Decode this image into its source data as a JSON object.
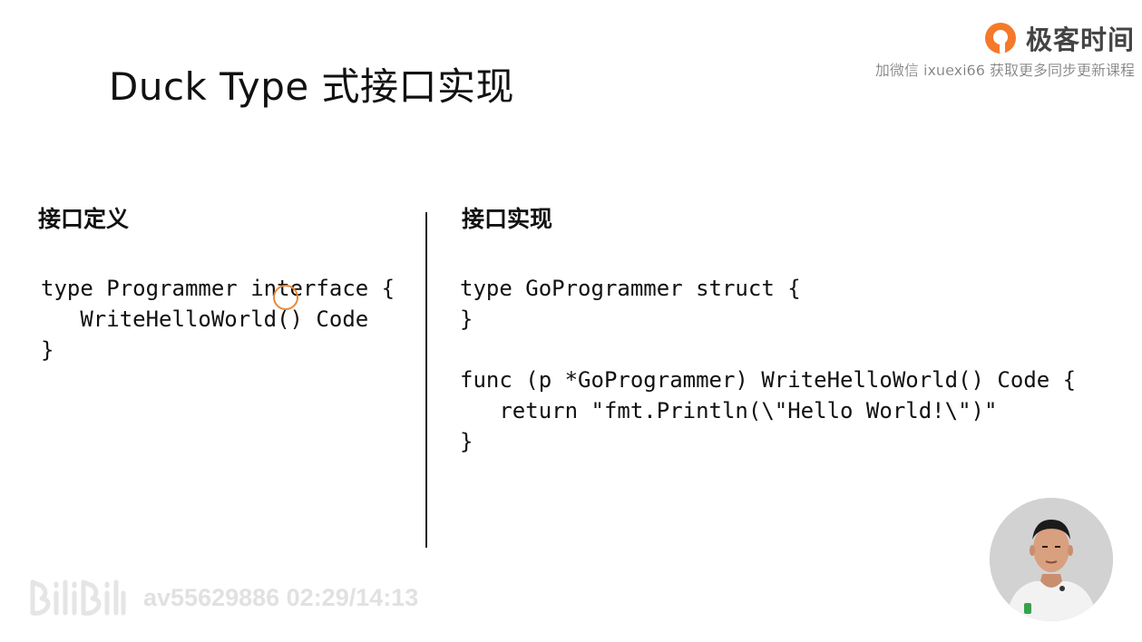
{
  "slide": {
    "title": "Duck Type 式接口实现"
  },
  "brand": {
    "name": "极客时间",
    "watermark": "加微信 ixuexi66 获取更多同步更新课程",
    "accent_color": "#f47a2a"
  },
  "left_panel": {
    "heading": "接口定义",
    "code": "type Programmer interface {\n   WriteHelloWorld() Code\n}"
  },
  "right_panel": {
    "heading": "接口实现",
    "code_block_1": "type GoProgrammer struct {\n}",
    "code_block_2": "func (p *GoProgrammer) WriteHelloWorld() Code {\n   return \"fmt.Println(\\\"Hello World!\\\")\"\n}"
  },
  "player": {
    "logo_icon": "bilibili-logo",
    "video_info": "av55629886 02:29/14:13"
  },
  "presenter": {
    "icon": "presenter-avatar"
  }
}
